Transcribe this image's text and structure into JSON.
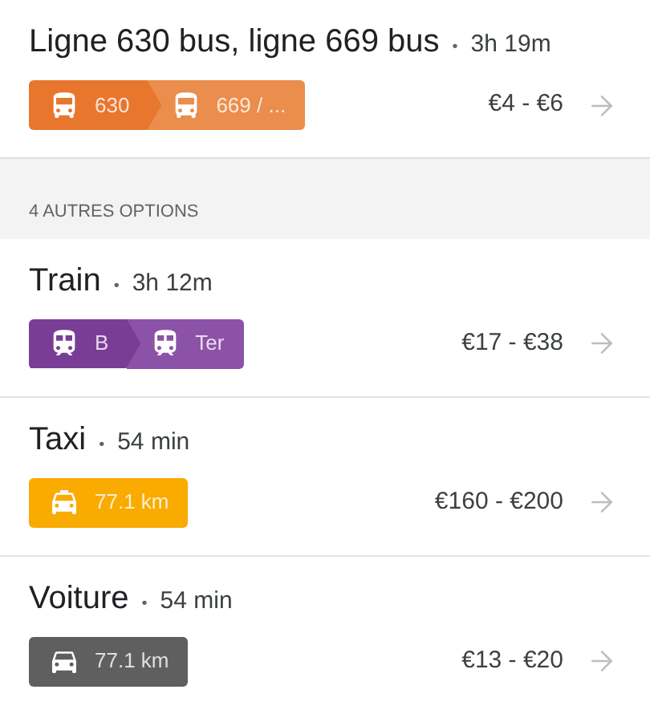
{
  "routes_top": [
    {
      "title": "Ligne 630 bus, ligne 669 bus",
      "separator": "•",
      "duration": "3h 19m",
      "segments": [
        {
          "kind": "bus",
          "label": "630",
          "color": "#e8762d"
        },
        {
          "kind": "bus",
          "label": "669 / ...",
          "color": "#eb8d4c"
        }
      ],
      "price": "€4 - €6"
    }
  ],
  "section_header": "4 AUTRES OPTIONS",
  "routes": [
    {
      "title": "Train",
      "separator": "•",
      "duration": "3h 12m",
      "segments": [
        {
          "kind": "train",
          "label": "B",
          "color": "#7a3d96"
        },
        {
          "kind": "train",
          "label": "Ter",
          "color": "#8c52a8"
        }
      ],
      "price": "€17 - €38"
    },
    {
      "title": "Taxi",
      "separator": "•",
      "duration": "54 min",
      "segments": [
        {
          "kind": "taxi",
          "label": "77.1 km",
          "color": "#f9ab00"
        }
      ],
      "price": "€160 - €200"
    },
    {
      "title": "Voiture",
      "separator": "•",
      "duration": "54 min",
      "segments": [
        {
          "kind": "car",
          "label": "77.1 km",
          "color": "#5f5f5f"
        }
      ],
      "price": "€13 - €20"
    }
  ]
}
